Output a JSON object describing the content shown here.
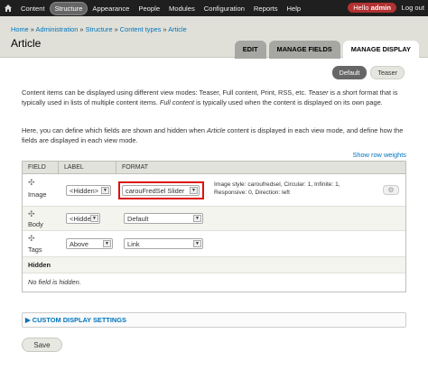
{
  "toolbar": {
    "items": [
      "Content",
      "Structure",
      "Appearance",
      "People",
      "Modules",
      "Configuration",
      "Reports",
      "Help"
    ],
    "active_index": 1,
    "user_prefix": "Hello ",
    "user_name": "admin",
    "logout": "Log out"
  },
  "breadcrumb": [
    "Home",
    "Administration",
    "Structure",
    "Content types",
    "Article"
  ],
  "page_title": "Article",
  "tabs": [
    {
      "label": "EDIT",
      "active": false
    },
    {
      "label": "MANAGE FIELDS",
      "active": false
    },
    {
      "label": "MANAGE DISPLAY",
      "active": true
    }
  ],
  "subtabs": [
    {
      "label": "Default",
      "active": true
    },
    {
      "label": "Teaser",
      "active": false
    }
  ],
  "help": {
    "p1_a": "Content items can be displayed using different view modes: Teaser, Full content, Print, RSS, etc. ",
    "p1_b": "Teaser",
    "p1_c": " is a short format that is typically used in lists of multiple content items. ",
    "p1_d": "Full content",
    "p1_e": " is typically used when the content is displayed on its own page.",
    "p2_a": "Here, you can define which fields are shown and hidden when ",
    "p2_b": "Article",
    "p2_c": " content is displayed in each view mode, and define how the fields are displayed in each view mode."
  },
  "show_row_weights": "Show row weights",
  "table": {
    "headers": [
      "Field",
      "Label",
      "Format"
    ],
    "rows": [
      {
        "field": "Image",
        "label": "<Hidden>",
        "format": "carouFredSel Slider",
        "summary": "Image style: caroufredsel, Circular: 1, Infinite: 1, Responsive: 0, Direction: left"
      },
      {
        "field": "Body",
        "label": "<Hidden>",
        "format": "Default"
      },
      {
        "field": "Tags",
        "label": "Above",
        "format": "Link"
      }
    ],
    "hidden_header": "Hidden",
    "no_field": "No field is hidden."
  },
  "custom_display": "CUSTOM DISPLAY SETTINGS",
  "save_label": "Save",
  "colors": {
    "toolbar": "#1f1f1f",
    "link": "#0074bd",
    "user_badge": "#b43131",
    "highlight": "#dd1111"
  }
}
